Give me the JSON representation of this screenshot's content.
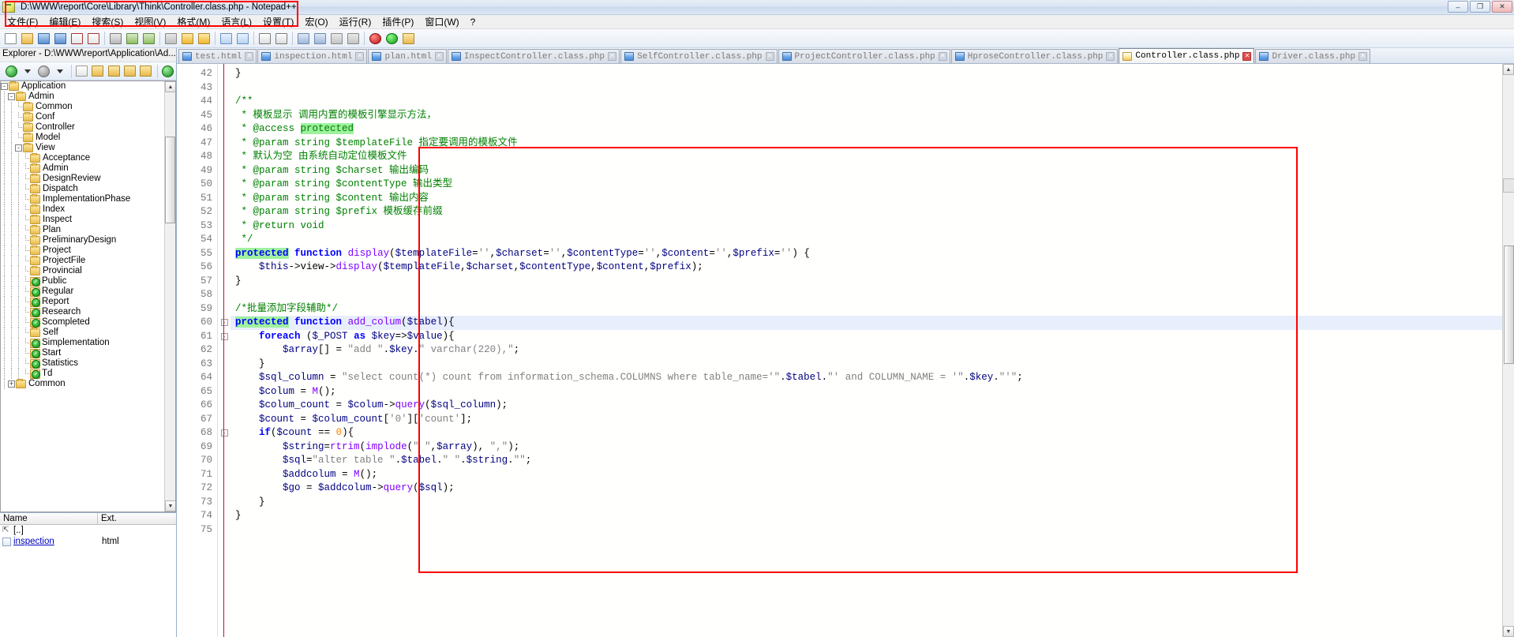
{
  "window": {
    "title": "D:\\WWW\\report\\Core\\Library\\Think\\Controller.class.php - Notepad++",
    "minimize_label": "–",
    "maximize_label": "❐",
    "close_label": "✕"
  },
  "menu": {
    "items": [
      {
        "label": "文件(F)"
      },
      {
        "label": "编辑(E)"
      },
      {
        "label": "搜索(S)"
      },
      {
        "label": "视图(V)"
      },
      {
        "label": "格式(M)"
      },
      {
        "label": "语言(L)"
      },
      {
        "label": "设置(T)"
      },
      {
        "label": "宏(O)"
      },
      {
        "label": "运行(R)"
      },
      {
        "label": "插件(P)"
      },
      {
        "label": "窗口(W)"
      },
      {
        "label": "?"
      }
    ]
  },
  "explorer": {
    "title": "Explorer - D:\\WWW\\report\\Application\\Ad...",
    "tree": [
      {
        "label": "Application",
        "depth": 1,
        "expander": "-",
        "icon": "folder-icon"
      },
      {
        "label": "Admin",
        "depth": 2,
        "expander": "-",
        "icon": "folder-icon"
      },
      {
        "label": "Common",
        "depth": 3,
        "expander": "",
        "icon": "folder-icon"
      },
      {
        "label": "Conf",
        "depth": 3,
        "expander": "",
        "icon": "folder-icon"
      },
      {
        "label": "Controller",
        "depth": 3,
        "expander": "",
        "icon": "folder-icon"
      },
      {
        "label": "Model",
        "depth": 3,
        "expander": "",
        "icon": "folder-icon"
      },
      {
        "label": "View",
        "depth": 3,
        "expander": "-",
        "icon": "folder-icon"
      },
      {
        "label": "Acceptance",
        "depth": 4,
        "expander": "",
        "icon": "folder-icon"
      },
      {
        "label": "Admin",
        "depth": 4,
        "expander": "",
        "icon": "folder-icon"
      },
      {
        "label": "DesignReview",
        "depth": 4,
        "expander": "",
        "icon": "folder-icon"
      },
      {
        "label": "Dispatch",
        "depth": 4,
        "expander": "",
        "icon": "folder-icon"
      },
      {
        "label": "ImplementationPhase",
        "depth": 4,
        "expander": "",
        "icon": "folder-icon"
      },
      {
        "label": "Index",
        "depth": 4,
        "expander": "",
        "icon": "folder-icon"
      },
      {
        "label": "Inspect",
        "depth": 4,
        "expander": "",
        "icon": "folder-icon"
      },
      {
        "label": "Plan",
        "depth": 4,
        "expander": "",
        "icon": "folder-icon"
      },
      {
        "label": "PreliminaryDesign",
        "depth": 4,
        "expander": "",
        "icon": "folder-icon"
      },
      {
        "label": "Project",
        "depth": 4,
        "expander": "",
        "icon": "folder-icon"
      },
      {
        "label": "ProjectFile",
        "depth": 4,
        "expander": "",
        "icon": "folder-icon"
      },
      {
        "label": "Provincial",
        "depth": 4,
        "expander": "",
        "icon": "folder-icon"
      },
      {
        "label": "Public",
        "depth": 4,
        "expander": "",
        "icon": "folder-checked-icon"
      },
      {
        "label": "Regular",
        "depth": 4,
        "expander": "",
        "icon": "folder-checked-icon"
      },
      {
        "label": "Report",
        "depth": 4,
        "expander": "",
        "icon": "folder-checked-icon"
      },
      {
        "label": "Research",
        "depth": 4,
        "expander": "",
        "icon": "folder-checked-icon"
      },
      {
        "label": "Scompleted",
        "depth": 4,
        "expander": "",
        "icon": "folder-checked-icon"
      },
      {
        "label": "Self",
        "depth": 4,
        "expander": "",
        "icon": "folder-icon"
      },
      {
        "label": "Simplementation",
        "depth": 4,
        "expander": "",
        "icon": "folder-checked-icon"
      },
      {
        "label": "Start",
        "depth": 4,
        "expander": "",
        "icon": "folder-checked-icon"
      },
      {
        "label": "Statistics",
        "depth": 4,
        "expander": "",
        "icon": "folder-checked-icon"
      },
      {
        "label": "Td",
        "depth": 4,
        "expander": "",
        "icon": "folder-checked-icon"
      },
      {
        "label": "Common",
        "depth": 2,
        "expander": "+",
        "icon": "folder-icon"
      }
    ],
    "filelist": {
      "columns": [
        "Name",
        "Ext."
      ],
      "rows": [
        {
          "name": "[..]",
          "ext": "",
          "icon": "parent-dir-icon"
        },
        {
          "name": "inspection",
          "ext": "html",
          "icon": "file-icon"
        }
      ]
    }
  },
  "tabs": [
    {
      "label": "test.html",
      "active": false
    },
    {
      "label": "inspection.html",
      "active": false
    },
    {
      "label": "plan.html",
      "active": false
    },
    {
      "label": "InspectController.class.php",
      "active": false
    },
    {
      "label": "SelfController.class.php",
      "active": false
    },
    {
      "label": "ProjectController.class.php",
      "active": false
    },
    {
      "label": "HproseController.class.php",
      "active": false
    },
    {
      "label": "Controller.class.php",
      "active": true
    },
    {
      "label": "Driver.class.php",
      "active": false
    }
  ],
  "editor": {
    "first_line": 42,
    "last_line": 75,
    "highlighted_line": 60,
    "colors": {
      "keyword": "#0000ff",
      "keyword2": "#8000ff",
      "string": "#808080",
      "comment": "#008000",
      "number": "#ff8000",
      "variable": "#000080",
      "highlight_green": "#9ef19e",
      "highlight_blue": "#b9cdf5",
      "annotation_red": "#ff0000"
    },
    "lines": [
      {
        "n": 42,
        "fold": "",
        "text": "}",
        "indent": 0
      },
      {
        "n": 43,
        "fold": "",
        "text": "",
        "indent": 0
      },
      {
        "n": 44,
        "fold": "",
        "text": "/**",
        "indent": 0
      },
      {
        "n": 45,
        "fold": "",
        "text": " * 模板显示 调用内置的模板引擎显示方法，",
        "indent": 0
      },
      {
        "n": 46,
        "fold": "",
        "text": " * @access protected",
        "indent": 0
      },
      {
        "n": 47,
        "fold": "",
        "text": " * @param string $templateFile 指定要调用的模板文件",
        "indent": 0
      },
      {
        "n": 48,
        "fold": "",
        "text": " * 默认为空 由系统自动定位模板文件",
        "indent": 0
      },
      {
        "n": 49,
        "fold": "",
        "text": " * @param string $charset 输出编码",
        "indent": 0
      },
      {
        "n": 50,
        "fold": "",
        "text": " * @param string $contentType 输出类型",
        "indent": 0
      },
      {
        "n": 51,
        "fold": "",
        "text": " * @param string $content 输出内容",
        "indent": 0
      },
      {
        "n": 52,
        "fold": "",
        "text": " * @param string $prefix 模板缓存前缀",
        "indent": 0
      },
      {
        "n": 53,
        "fold": "",
        "text": " * @return void",
        "indent": 0
      },
      {
        "n": 54,
        "fold": "",
        "text": " */",
        "indent": 0
      },
      {
        "n": 55,
        "fold": "",
        "text": "protected function display($templateFile='',$charset='',$contentType='',$content='',$prefix='') {",
        "indent": 0
      },
      {
        "n": 56,
        "fold": "",
        "text": "    $this->view->display($templateFile,$charset,$contentType,$content,$prefix);",
        "indent": 1
      },
      {
        "n": 57,
        "fold": "",
        "text": "}",
        "indent": 0
      },
      {
        "n": 58,
        "fold": "",
        "text": "",
        "indent": 0
      },
      {
        "n": 59,
        "fold": "",
        "text": "/*批量添加字段辅助*/",
        "indent": 0
      },
      {
        "n": 60,
        "fold": "-",
        "text": "protected function add_colum($tabel){",
        "indent": 0
      },
      {
        "n": 61,
        "fold": "-",
        "text": "    foreach ($_POST as $key=>$value){",
        "indent": 1
      },
      {
        "n": 62,
        "fold": "",
        "text": "        $array[] = \"add \".$key.\" varchar(220),\";",
        "indent": 2
      },
      {
        "n": 63,
        "fold": "",
        "text": "    }",
        "indent": 1
      },
      {
        "n": 64,
        "fold": "",
        "text": "    $sql_column = \"select count(*) count from information_schema.COLUMNS where table_name='\".$tabel.\"' and COLUMN_NAME = '\".$key.\"'\";",
        "indent": 1
      },
      {
        "n": 65,
        "fold": "",
        "text": "    $colum = M();",
        "indent": 1
      },
      {
        "n": 66,
        "fold": "",
        "text": "    $colum_count = $colum->query($sql_column);",
        "indent": 1
      },
      {
        "n": 67,
        "fold": "",
        "text": "    $count = $colum_count['0']['count'];",
        "indent": 1
      },
      {
        "n": 68,
        "fold": "-",
        "text": "    if($count == 0){",
        "indent": 1
      },
      {
        "n": 69,
        "fold": "",
        "text": "        $string=rtrim(implode(\" \",$array), \",\");",
        "indent": 2
      },
      {
        "n": 70,
        "fold": "",
        "text": "        $sql=\"alter table \".$tabel.\" \".$string.\"\";",
        "indent": 2
      },
      {
        "n": 71,
        "fold": "",
        "text": "        $addcolum = M();",
        "indent": 2
      },
      {
        "n": 72,
        "fold": "",
        "text": "        $go = $addcolum->query($sql);",
        "indent": 2
      },
      {
        "n": 73,
        "fold": "",
        "text": "    }",
        "indent": 1
      },
      {
        "n": 74,
        "fold": "",
        "text": "}",
        "indent": 0
      },
      {
        "n": 75,
        "fold": "",
        "text": "",
        "indent": 0
      }
    ]
  }
}
